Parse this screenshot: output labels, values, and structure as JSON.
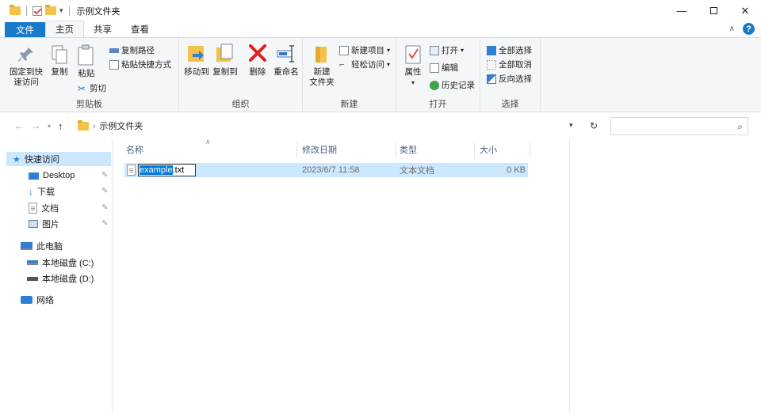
{
  "window": {
    "title": "示例文件夹",
    "minimize": "—",
    "close": "✕"
  },
  "ribbon_tabs": [
    {
      "label": "文件"
    },
    {
      "label": "主页"
    },
    {
      "label": "共享"
    },
    {
      "label": "查看"
    }
  ],
  "ribbon": {
    "clipboard": {
      "group_label": "剪贴板",
      "pin_quick": "固定到快\n速访问",
      "copy": "复制",
      "paste": "粘贴",
      "copy_path": "复制路径",
      "paste_shortcut": "粘贴快捷方式",
      "cut": "剪切"
    },
    "organize": {
      "group_label": "组织",
      "move_to": "移动到",
      "copy_to": "复制到",
      "delete": "删除",
      "rename": "重命名"
    },
    "new": {
      "group_label": "新建",
      "new_folder": "新建\n文件夹",
      "new_item": "新建项目",
      "easy_access": "轻松访问"
    },
    "open": {
      "group_label": "打开",
      "properties": "属性",
      "open": "打开",
      "edit": "编辑",
      "history": "历史记录"
    },
    "select": {
      "group_label": "选择",
      "select_all": "全部选择",
      "select_none": "全部取消",
      "invert": "反向选择"
    }
  },
  "address": {
    "path": "示例文件夹"
  },
  "search": {
    "placeholder": ""
  },
  "nav_pane": {
    "quick_access": "快速访问",
    "items": [
      {
        "label": "Desktop"
      },
      {
        "label": "下载"
      },
      {
        "label": "文档"
      },
      {
        "label": "图片"
      }
    ],
    "this_pc": "此电脑",
    "drives": [
      {
        "label": "本地磁盘 (C:)"
      },
      {
        "label": "本地磁盘 (D:)"
      }
    ],
    "network": "网络"
  },
  "file_list": {
    "columns": [
      "名称",
      "修改日期",
      "类型",
      "大小"
    ],
    "rows": [
      {
        "name_selected": "example",
        "name_rest": ".txt",
        "modified": "2023/6/7 11:58",
        "type": "文本文档",
        "size": "0 KB"
      }
    ]
  },
  "colors": {
    "accent": "#1979ca",
    "selection": "#cce8ff",
    "text_select": "#0078d7"
  }
}
